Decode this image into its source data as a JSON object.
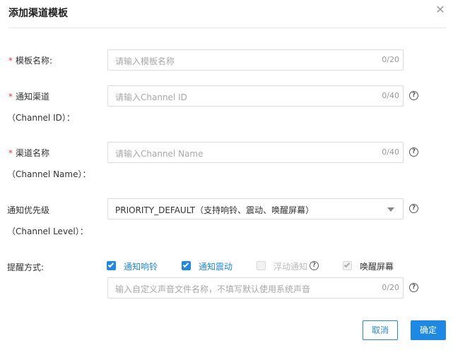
{
  "dialog": {
    "title": "添加渠道模板",
    "close_icon": "close-icon"
  },
  "fields": {
    "template_name": {
      "required": "*",
      "label": "模板名称:",
      "placeholder": "请输入模板名称",
      "count": "0/20"
    },
    "channel_id": {
      "required": "*",
      "label": "通知渠道",
      "sublabel": "（Channel ID）：",
      "placeholder": "请输入Channel ID",
      "count": "0/40"
    },
    "channel_name": {
      "required": "*",
      "label": "渠道名称",
      "sublabel": "（Channel Name）：",
      "placeholder": "请输入Channel Name",
      "count": "0/40"
    },
    "channel_level": {
      "label": "通知优先级",
      "sublabel": "（Channel Level）：",
      "value": "PRIORITY_DEFAULT（支持响铃、震动、唤醒屏幕）"
    },
    "reminder": {
      "label": "提醒方式:",
      "options": [
        {
          "label": "通知响铃",
          "checked": true
        },
        {
          "label": "通知震动",
          "checked": true
        },
        {
          "label": "浮动通知",
          "checked": false,
          "disabled": true
        },
        {
          "label": "唤醒屏幕",
          "checked": true,
          "disabled": true
        }
      ],
      "sound_placeholder": "输入自定义声音文件名称，不填写默认使用系统声音",
      "sound_count": "0/20"
    }
  },
  "footer": {
    "cancel_label": "取消",
    "ok_label": "确定"
  },
  "colors": {
    "accent": "#1e88e5",
    "required": "#e4393c"
  }
}
